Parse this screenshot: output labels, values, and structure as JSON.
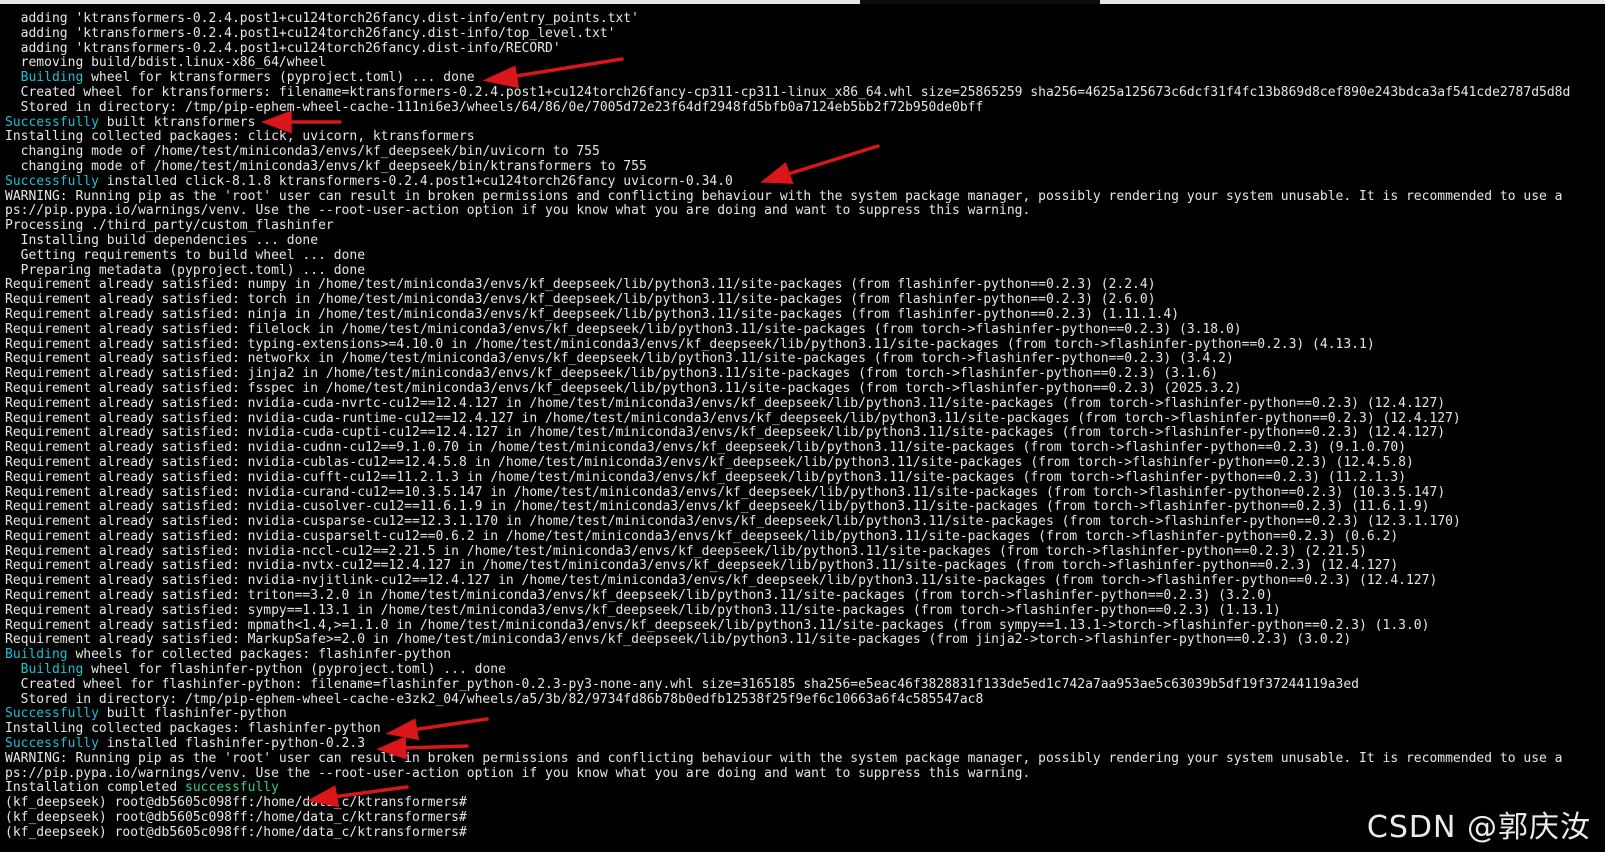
{
  "watermark": "CSDN @郭庆汝",
  "colors": {
    "background": "#000000",
    "default": "#e6e6e6",
    "cyan": "#16c2d4",
    "magenta": "#e066e6",
    "yellow": "#d5d546",
    "arrow": "#d9161a"
  },
  "lines": [
    [
      {
        "t": "  adding 'ktransformers-0.2.4.post1+cu124torch26fancy.dist-info/entry_points.txt'"
      }
    ],
    [
      {
        "t": "  adding 'ktransformers-0.2.4.post1+cu124torch26fancy.dist-info/top_level.txt'"
      }
    ],
    [
      {
        "t": "  adding 'ktransformers-0.2.4.post1+cu124torch26fancy.dist-info/RECORD'"
      }
    ],
    [
      {
        "t": "  removing build/bdist.linux-x86_64/wheel"
      }
    ],
    [
      {
        "t": "  "
      },
      {
        "t": "Building",
        "c": "cyan"
      },
      {
        "t": " wheel for ktransformers (pyproject.toml) ... done"
      }
    ],
    [
      {
        "t": "  Created wheel for ktransformers: filename=ktransformers-0.2.4.post1+cu124torch26fancy-cp311-cp311-linux_x86_64.whl size=25865259 sha256=4625a125673c6dcf31f4fc13b869d8cef890e243bdca3af541cde2787d5d8d"
      }
    ],
    [
      {
        "t": "  Stored in directory: /tmp/pip-ephem-wheel-cache-111ni6e3/wheels/64/86/0e/7005d72e23f64df2948fd5bfb0a7124eb5bb2f72b950de0bff"
      }
    ],
    [
      {
        "t": "Successfully",
        "c": "cyan"
      },
      {
        "t": " built ktransformers"
      }
    ],
    [
      {
        "t": "Installing collected packages: click, uvicorn, ktransformers"
      }
    ],
    [
      {
        "t": "  changing mode of /home/test/miniconda3/envs/kf_deepseek/bin/uvicorn to 755"
      }
    ],
    [
      {
        "t": "  changing mode of /home/test/miniconda3/envs/kf_deepseek/bin/ktransformers to 755"
      }
    ],
    [
      {
        "t": "Successfully",
        "c": "cyan"
      },
      {
        "t": " installed click-8.1.8 ktransformers-0.2.4.post1+cu124torch26fancy uvicorn-0.34.0"
      }
    ],
    [
      {
        "t": "WARNING: Running pip as the 'root' user can result in broken permissions and conflicting behaviour with the system package manager, possibly rendering your system unusable. It is recommended to use a",
        "c": "yellow"
      }
    ],
    [
      {
        "t": "ps://pip.pypa.io/warnings/venv. Use the --root-user-action option if you know what you are doing and want to suppress this warning.",
        "c": "yellow"
      }
    ],
    [
      {
        "t": "Processing ./third_party/custom_flashinfer"
      }
    ],
    [
      {
        "t": "  Installing build dependencies ... done"
      }
    ],
    [
      {
        "t": "  Getting requirements to build wheel ... done"
      }
    ],
    [
      {
        "t": "  Preparing metadata (pyproject.toml) ... done"
      }
    ],
    [
      {
        "t": "Requirement already satisfied: numpy in /home/test/miniconda3/envs/kf_deepseek/lib/python3.11/site-packages (from flashinfer-python==0.2.3) (2.2.4)"
      }
    ],
    [
      {
        "t": "Requirement already satisfied: torch in /home/test/miniconda3/envs/kf_deepseek/lib/python3.11/site-packages (from flashinfer-python==0.2.3) (2.6.0)"
      }
    ],
    [
      {
        "t": "Requirement already satisfied: ninja in /home/test/miniconda3/envs/kf_deepseek/lib/python3.11/site-packages (from flashinfer-python==0.2.3) ("
      },
      {
        "t": "1.11.1.4",
        "c": "magenta"
      },
      {
        "t": ")"
      }
    ],
    [
      {
        "t": "Requirement already satisfied: filelock in /home/test/miniconda3/envs/kf_deepseek/lib/python3.11/site-packages (from torch->flashinfer-python==0.2.3) (3.18.0)"
      }
    ],
    [
      {
        "t": "Requirement already satisfied: typing-extensions>=4.10.0 in /home/test/miniconda3/envs/kf_deepseek/lib/python3.11/site-packages (from torch->flashinfer-python==0.2.3) (4.13.1)"
      }
    ],
    [
      {
        "t": "Requirement already satisfied: networkx in /home/test/miniconda3/envs/kf_deepseek/lib/python3.11/site-packages (from torch->flashinfer-python==0.2.3) (3.4.2)"
      }
    ],
    [
      {
        "t": "Requirement already satisfied: jinja2 in /home/test/miniconda3/envs/kf_deepseek/lib/python3.11/site-packages (from torch->flashinfer-python==0.2.3) (3.1.6)"
      }
    ],
    [
      {
        "t": "Requirement already satisfied: fsspec in /home/test/miniconda3/envs/kf_deepseek/lib/python3.11/site-packages (from torch->flashinfer-python==0.2.3) (2025.3.2)"
      }
    ],
    [
      {
        "t": "Requirement already satisfied: nvidia-cuda-nvrtc-cu12==12.4.127 in /home/test/miniconda3/envs/kf_deepseek/lib/python3.11/site-packages (from torch->flashinfer-python==0.2.3) (12.4.127)"
      }
    ],
    [
      {
        "t": "Requirement already satisfied: nvidia-cuda-runtime-cu12==12.4.127 in /home/test/miniconda3/envs/kf_deepseek/lib/python3.11/site-packages (from torch->flashinfer-python==0.2.3) (12.4.127)"
      }
    ],
    [
      {
        "t": "Requirement already satisfied: nvidia-cuda-cupti-cu12==12.4.127 in /home/test/miniconda3/envs/kf_deepseek/lib/python3.11/site-packages (from torch->flashinfer-python==0.2.3) (12.4.127)"
      }
    ],
    [
      {
        "t": "Requirement already satisfied: nvidia-cudnn-cu12=="
      },
      {
        "t": "9.1.0.70",
        "c": "magenta"
      },
      {
        "t": " in /home/test/miniconda3/envs/kf_deepseek/lib/python3.11/site-packages (from torch->flashinfer-python==0.2.3) ("
      },
      {
        "t": "9.1.0.70",
        "c": "magenta"
      },
      {
        "t": ")"
      }
    ],
    [
      {
        "t": "Requirement already satisfied: nvidia-cublas-cu12=="
      },
      {
        "t": "12.4.5.8",
        "c": "magenta"
      },
      {
        "t": " in /home/test/miniconda3/envs/kf_deepseek/lib/python3.11/site-packages (from torch->flashinfer-python==0.2.3) ("
      },
      {
        "t": "12.4.5.8",
        "c": "magenta"
      },
      {
        "t": ")"
      }
    ],
    [
      {
        "t": "Requirement already satisfied: nvidia-cufft-cu12=="
      },
      {
        "t": "11.2.1.3",
        "c": "magenta"
      },
      {
        "t": " in /home/test/miniconda3/envs/kf_deepseek/lib/python3.11/site-packages (from torch->flashinfer-python==0.2.3) ("
      },
      {
        "t": "11.2.1.3",
        "c": "magenta"
      },
      {
        "t": ")"
      }
    ],
    [
      {
        "t": "Requirement already satisfied: nvidia-curand-cu12=="
      },
      {
        "t": "10.3.5.147",
        "c": "magenta"
      },
      {
        "t": " in /home/test/miniconda3/envs/kf_deepseek/lib/python3.11/site-packages (from torch->flashinfer-python==0.2.3) ("
      },
      {
        "t": "10.3.5.147",
        "c": "magenta"
      },
      {
        "t": ")"
      }
    ],
    [
      {
        "t": "Requirement already satisfied: nvidia-cusolver-cu12=="
      },
      {
        "t": "11.6.1.9",
        "c": "magenta"
      },
      {
        "t": " in /home/test/miniconda3/envs/kf_deepseek/lib/python3.11/site-packages (from torch->flashinfer-python==0.2.3) ("
      },
      {
        "t": "11.6.1.9",
        "c": "magenta"
      },
      {
        "t": ")"
      }
    ],
    [
      {
        "t": "Requirement already satisfied: nvidia-cusparse-cu12=="
      },
      {
        "t": "12.3.1.170",
        "c": "magenta"
      },
      {
        "t": " in /home/test/miniconda3/envs/kf_deepseek/lib/python3.11/site-packages (from torch->flashinfer-python==0.2.3) ("
      },
      {
        "t": "12.3.1.170",
        "c": "magenta"
      },
      {
        "t": ")"
      }
    ],
    [
      {
        "t": "Requirement already satisfied: nvidia-cusparselt-cu12==0.6.2 in /home/test/miniconda3/envs/kf_deepseek/lib/python3.11/site-packages (from torch->flashinfer-python==0.2.3) (0.6.2)"
      }
    ],
    [
      {
        "t": "Requirement already satisfied: nvidia-nccl-cu12==2.21.5 in /home/test/miniconda3/envs/kf_deepseek/lib/python3.11/site-packages (from torch->flashinfer-python==0.2.3) (2.21.5)"
      }
    ],
    [
      {
        "t": "Requirement already satisfied: nvidia-nvtx-cu12==12.4.127 in /home/test/miniconda3/envs/kf_deepseek/lib/python3.11/site-packages (from torch->flashinfer-python==0.2.3) (12.4.127)"
      }
    ],
    [
      {
        "t": "Requirement already satisfied: nvidia-nvjitlink-cu12==12.4.127 in /home/test/miniconda3/envs/kf_deepseek/lib/python3.11/site-packages (from torch->flashinfer-python==0.2.3) (12.4.127)"
      }
    ],
    [
      {
        "t": "Requirement already satisfied: triton==3.2.0 in /home/test/miniconda3/envs/kf_deepseek/lib/python3.11/site-packages (from torch->flashinfer-python==0.2.3) (3.2.0)"
      }
    ],
    [
      {
        "t": "Requirement already satisfied: sympy==1.13.1 in /home/test/miniconda3/envs/kf_deepseek/lib/python3.11/site-packages (from torch->flashinfer-python==0.2.3) (1.13.1)"
      }
    ],
    [
      {
        "t": "Requirement already satisfied: mpmath<1.4,>=1.1.0 in /home/test/miniconda3/envs/kf_deepseek/lib/python3.11/site-packages (from sympy==1.13.1->torch->flashinfer-python==0.2.3) (1.3.0)"
      }
    ],
    [
      {
        "t": "Requirement already satisfied: MarkupSafe>=2.0 in /home/test/miniconda3/envs/kf_deepseek/lib/python3.11/site-packages (from jinja2->torch->flashinfer-python==0.2.3) (3.0.2)"
      }
    ],
    [
      {
        "t": "Building",
        "c": "cyan"
      },
      {
        "t": " wheels for collected packages: flashinfer-python"
      }
    ],
    [
      {
        "t": "  "
      },
      {
        "t": "Building",
        "c": "cyan"
      },
      {
        "t": " wheel for flashinfer-python (pyproject.toml) ... done"
      }
    ],
    [
      {
        "t": "  Created wheel for flashinfer-python: filename=flashinfer_python-0.2.3-py3-none-any.whl size=3165185 sha256=e5eac46f3828831f133de5ed1c742a7aa953ae5c63039b5df19f37244119a3ed"
      }
    ],
    [
      {
        "t": "  Stored in directory: /tmp/pip-ephem-wheel-cache-e3zk2_04/wheels/a5/3b/82/9734fd86b78b0edfb12538f25f9ef6c10663a6f4c585547ac8"
      }
    ],
    [
      {
        "t": "Successfully",
        "c": "cyan"
      },
      {
        "t": " built flashinfer-python"
      }
    ],
    [
      {
        "t": "Installing collected packages: flashinfer-python"
      }
    ],
    [
      {
        "t": "Successfully",
        "c": "cyan"
      },
      {
        "t": " installed flashinfer-python-0.2.3"
      }
    ],
    [
      {
        "t": "WARNING: Running pip as the 'root' user can result in broken permissions and conflicting behaviour with the system package manager, possibly rendering your system unusable. It is recommended to use a",
        "c": "yellow"
      }
    ],
    [
      {
        "t": "ps://pip.pypa.io/warnings/venv. Use the --root-user-action option if you know what you are doing and want to suppress this warning.",
        "c": "yellow"
      }
    ],
    [
      {
        "t": "Installation completed "
      },
      {
        "t": "successfully",
        "c": "green"
      }
    ],
    [
      {
        "t": "(kf_deepseek) root@db5605c098ff:/home/data_c/ktransformers#"
      }
    ],
    [
      {
        "t": "(kf_deepseek) root@db5605c098ff:/home/data_c/ktransformers#"
      }
    ],
    [
      {
        "t": "(kf_deepseek) root@db5605c098ff:/home/data_c/ktransformers#"
      }
    ]
  ]
}
